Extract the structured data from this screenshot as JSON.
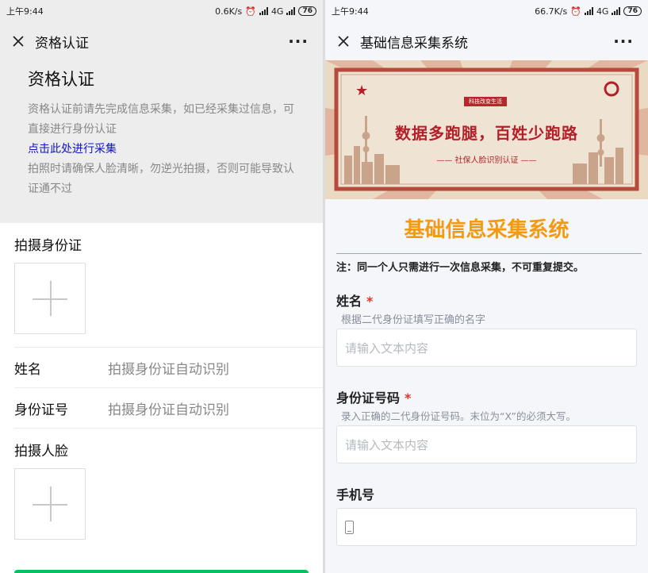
{
  "left": {
    "status": {
      "time": "上午9:44",
      "speed": "0.6K/s",
      "network": "4G",
      "battery": "76"
    },
    "nav": {
      "title": "资格认证"
    },
    "intro": {
      "heading": "资格认证",
      "text1": "资格认证前请先完成信息采集，如已经采集过信息，可直接进行身份认证",
      "link": "点击此处进行采集",
      "text2": "拍照时请确保人脸清晰，勿逆光拍摄，否则可能导致认证通不过"
    },
    "form": {
      "id_photo_label": "拍摄身份证",
      "name_label": "姓名",
      "name_value": "拍摄身份证自动识别",
      "id_label": "身份证号",
      "id_value": "拍摄身份证自动识别",
      "face_label": "拍摄人脸"
    }
  },
  "right": {
    "status": {
      "time": "上午9:44",
      "speed": "66.7K/s",
      "network": "4G",
      "battery": "76"
    },
    "nav": {
      "title": "基础信息采集系统"
    },
    "banner": {
      "tag": "科技改变生活",
      "slogan": "数据多跑腿，百姓少跑路",
      "sub": "—— 社保人脸识别认证 ——"
    },
    "title": "基础信息采集系统",
    "note": "注：同一个人只需进行一次信息采集，不可重复提交。",
    "fields": [
      {
        "label": "姓名",
        "required": "*",
        "hint": "根据二代身份证填写正确的名字",
        "placeholder": "请输入文本内容"
      },
      {
        "label": "身份证号码",
        "required": "*",
        "hint": "录入正确的二代身份证号码。末位为“X”的必须大写。",
        "placeholder": "请输入文本内容"
      },
      {
        "label": "手机号"
      }
    ],
    "colors": {
      "accent": "#f39a12",
      "banner_red": "#b3202a"
    }
  }
}
